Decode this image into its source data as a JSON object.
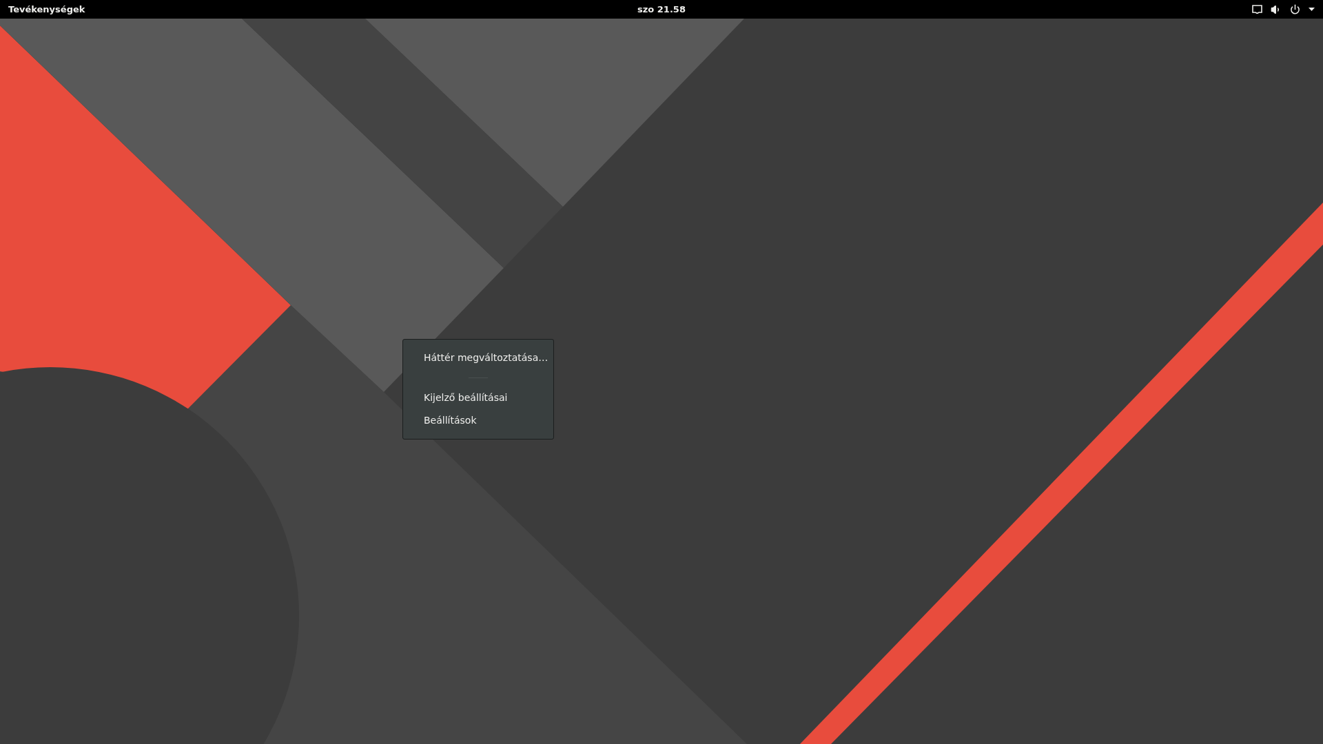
{
  "top_bar": {
    "activities": "Tevékenységek",
    "clock": "szo 21.58"
  },
  "context_menu": {
    "items": [
      {
        "kind": "item",
        "label": "Háttér megváltoztatása…"
      },
      {
        "kind": "separator"
      },
      {
        "kind": "item",
        "label": "Kijelző beállításai"
      },
      {
        "kind": "item",
        "label": "Beállítások"
      }
    ]
  }
}
